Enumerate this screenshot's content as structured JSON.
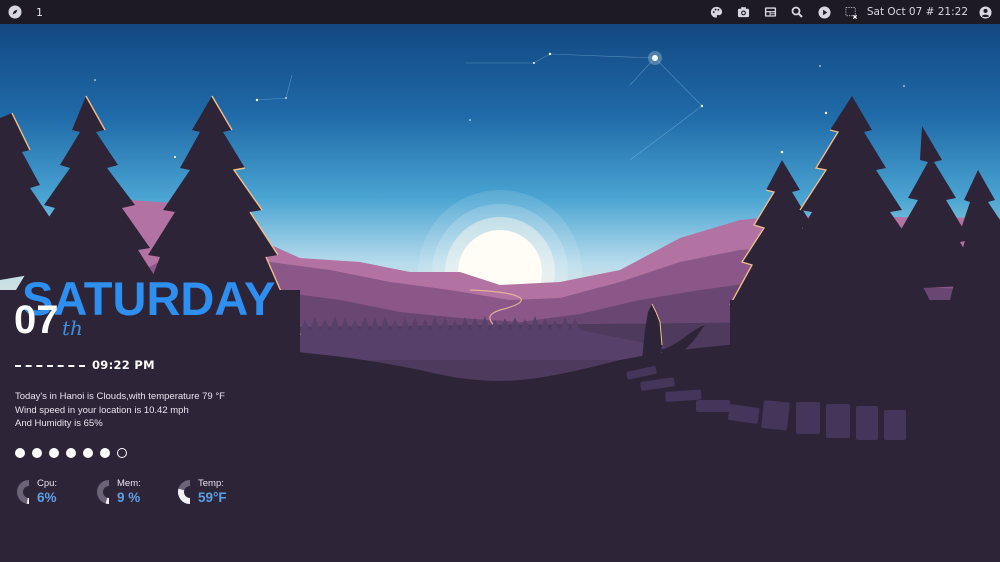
{
  "topbar": {
    "workspace": "1",
    "clock": "Sat Oct 07 # 21:22",
    "icons": [
      "launcher-icon",
      "palette-icon",
      "camera-icon",
      "layout-icon",
      "search-icon",
      "play-icon",
      "screen-icon",
      "user-icon"
    ]
  },
  "desktop": {
    "day": "SATURDAY",
    "date": "07",
    "ordinal": "th",
    "time": "09:22 PM",
    "weather_lines": [
      "Today's in Hanoi is Clouds,with temperature 79 °F",
      "Wind speed in your location is 10.42 mph",
      "And Humidity is 65%"
    ],
    "dots": [
      1,
      1,
      1,
      1,
      1,
      1,
      0
    ],
    "stats": [
      {
        "label": "Cpu:",
        "value": "6%",
        "fraction": 0.06
      },
      {
        "label": "Mem:",
        "value": "9 %",
        "fraction": 0.09
      },
      {
        "label": "Temp:",
        "value": "59°F",
        "fraction": 0.59
      }
    ]
  },
  "colors": {
    "accent": "#2d8ff0",
    "value": "#5aa0e6",
    "topbar": "#1d1a24",
    "ground": "#2e2438"
  }
}
